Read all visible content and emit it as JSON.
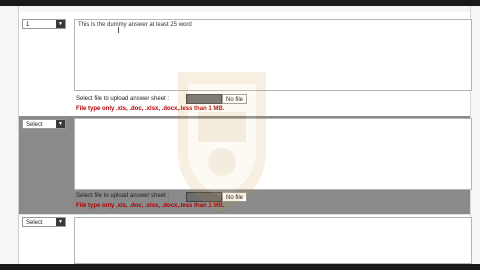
{
  "row1": {
    "select_value": "1",
    "answer_text": "This is the dummy answer at least 25 word",
    "upload_label": "Select file to upload answer sheet :",
    "upload_status": "No file",
    "filetype_note": "File type only .xls, .doc, .xlsx, .docx,.less than 1 MB."
  },
  "row2": {
    "select_value": "Select",
    "answer_text": "",
    "upload_label": "Select file to upload answer sheet :",
    "upload_status": "No file",
    "filetype_note": "File type only .xls, .doc, .xlsx, .docx,.less than 1 MB."
  },
  "row3": {
    "select_value": "Select",
    "answer_text": ""
  },
  "colors": {
    "error_text": "#b00000",
    "dark_panel": "#8a8a8a",
    "frame_bar": "#1a1a1a"
  },
  "icons": {
    "dropdown": "chevron-down-icon",
    "watermark": "shield-logo-watermark"
  }
}
